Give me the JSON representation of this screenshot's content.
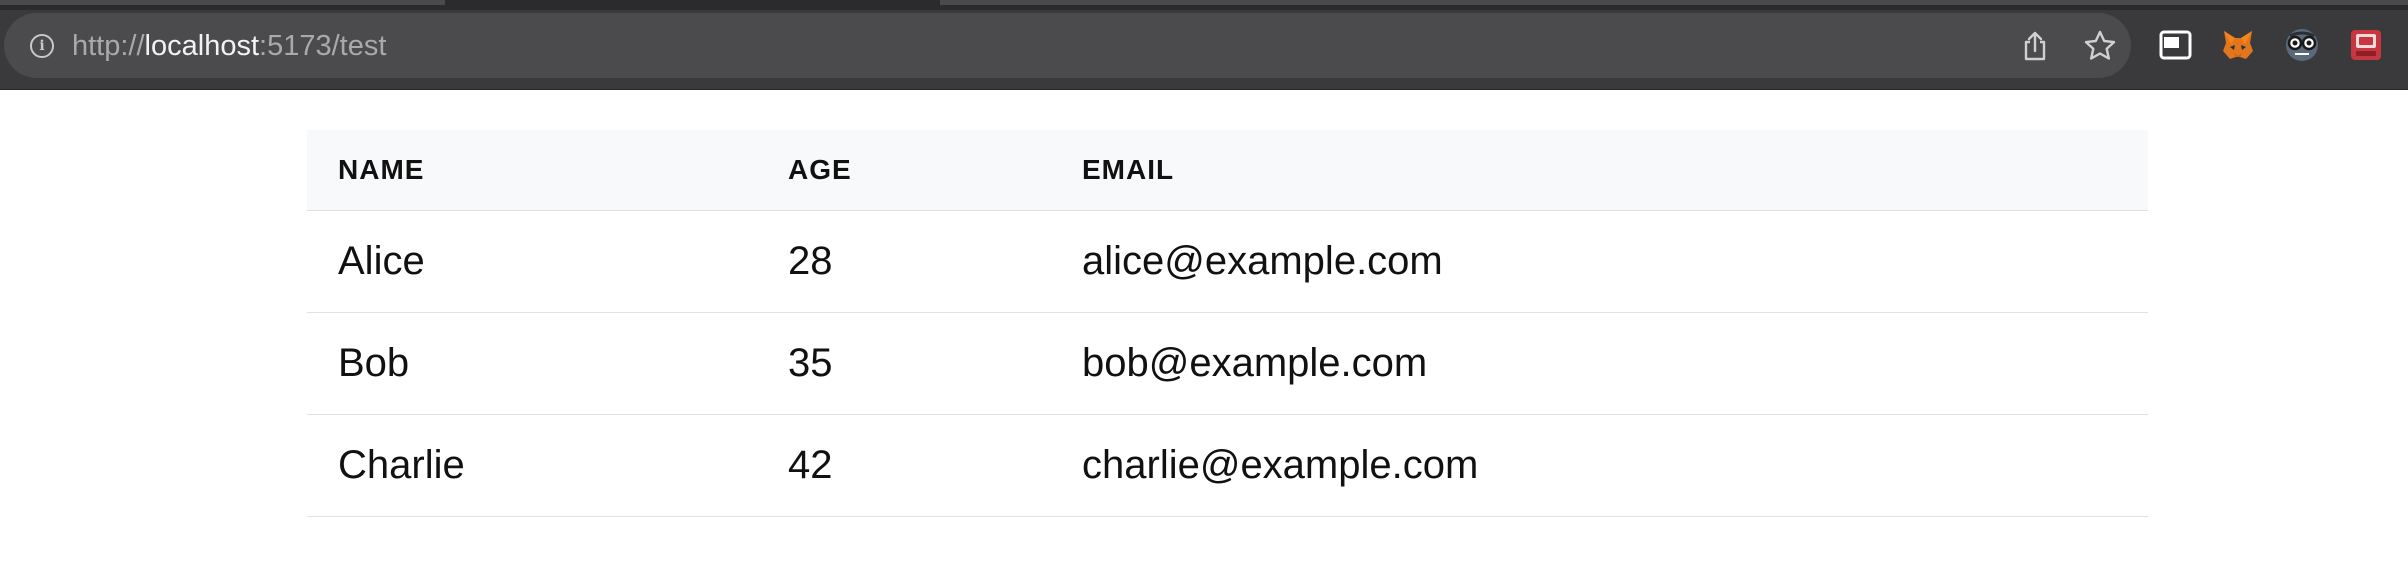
{
  "browser": {
    "url_scheme": "http://",
    "url_host": "localhost",
    "url_rest": ":5173/test",
    "icons": {
      "site_info": "info-icon",
      "share": "share-icon",
      "bookmark": "star-icon",
      "picture_in_picture": "pip-icon",
      "extensions": [
        "metamask-fox-icon",
        "glasses-extension-icon",
        "red-extension-icon"
      ]
    }
  },
  "table": {
    "headers": [
      "NAME",
      "AGE",
      "EMAIL"
    ],
    "rows": [
      {
        "name": "Alice",
        "age": "28",
        "email": "alice@example.com"
      },
      {
        "name": "Bob",
        "age": "35",
        "email": "bob@example.com"
      },
      {
        "name": "Charlie",
        "age": "42",
        "email": "charlie@example.com"
      }
    ]
  },
  "colors": {
    "chrome_bg": "#3a3a3c",
    "omnibox_bg": "#4b4b4d",
    "header_row_bg": "#f8f9fa",
    "row_border": "#dee2e6",
    "text": "#111111"
  }
}
